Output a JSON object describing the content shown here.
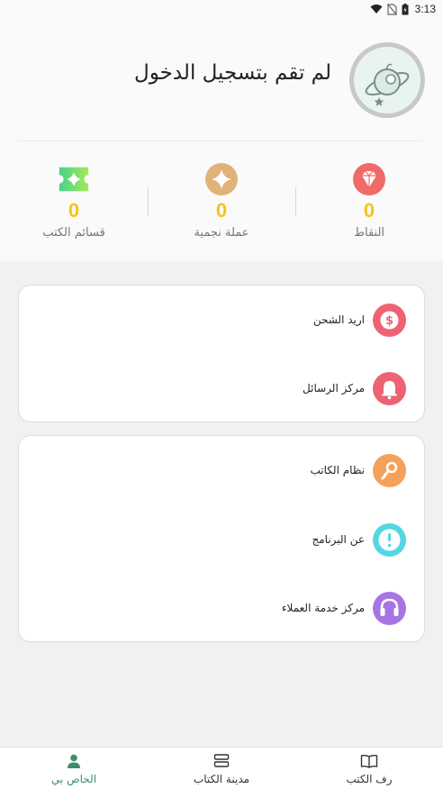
{
  "status_bar": {
    "time": "3:13"
  },
  "header": {
    "login_text": "لم تقم بتسجيل الدخول"
  },
  "stats": [
    {
      "value": "0",
      "label": "النقاط",
      "icon": "diamond-icon",
      "color": "#f06a6a"
    },
    {
      "value": "0",
      "label": "عملة نجمية",
      "icon": "star-coin-icon",
      "color": "#e0b27a"
    },
    {
      "value": "0",
      "label": "قسائم الكتب",
      "icon": "ticket-icon",
      "color": "#5fd38a"
    }
  ],
  "menu_group_1": [
    {
      "label": "اريد الشحن",
      "icon": "dollar-icon",
      "color": "#ee6373"
    },
    {
      "label": "مركز الرسائل",
      "icon": "bell-icon",
      "color": "#ee6373"
    }
  ],
  "menu_group_2": [
    {
      "label": "نظام الكاتب",
      "icon": "pen-icon",
      "color": "#f4a15a"
    },
    {
      "label": "عن البرنامج",
      "icon": "info-icon",
      "color": "#55d6e3"
    },
    {
      "label": "مركز خدمة العملاء",
      "icon": "headset-icon",
      "color": "#a874e4"
    }
  ],
  "nav": [
    {
      "label": "رف الكتب",
      "icon": "book-icon",
      "active": false
    },
    {
      "label": "مدينة الكتاب",
      "icon": "stack-icon",
      "active": false
    },
    {
      "label": "الخاص بي",
      "icon": "person-icon",
      "active": true
    }
  ]
}
